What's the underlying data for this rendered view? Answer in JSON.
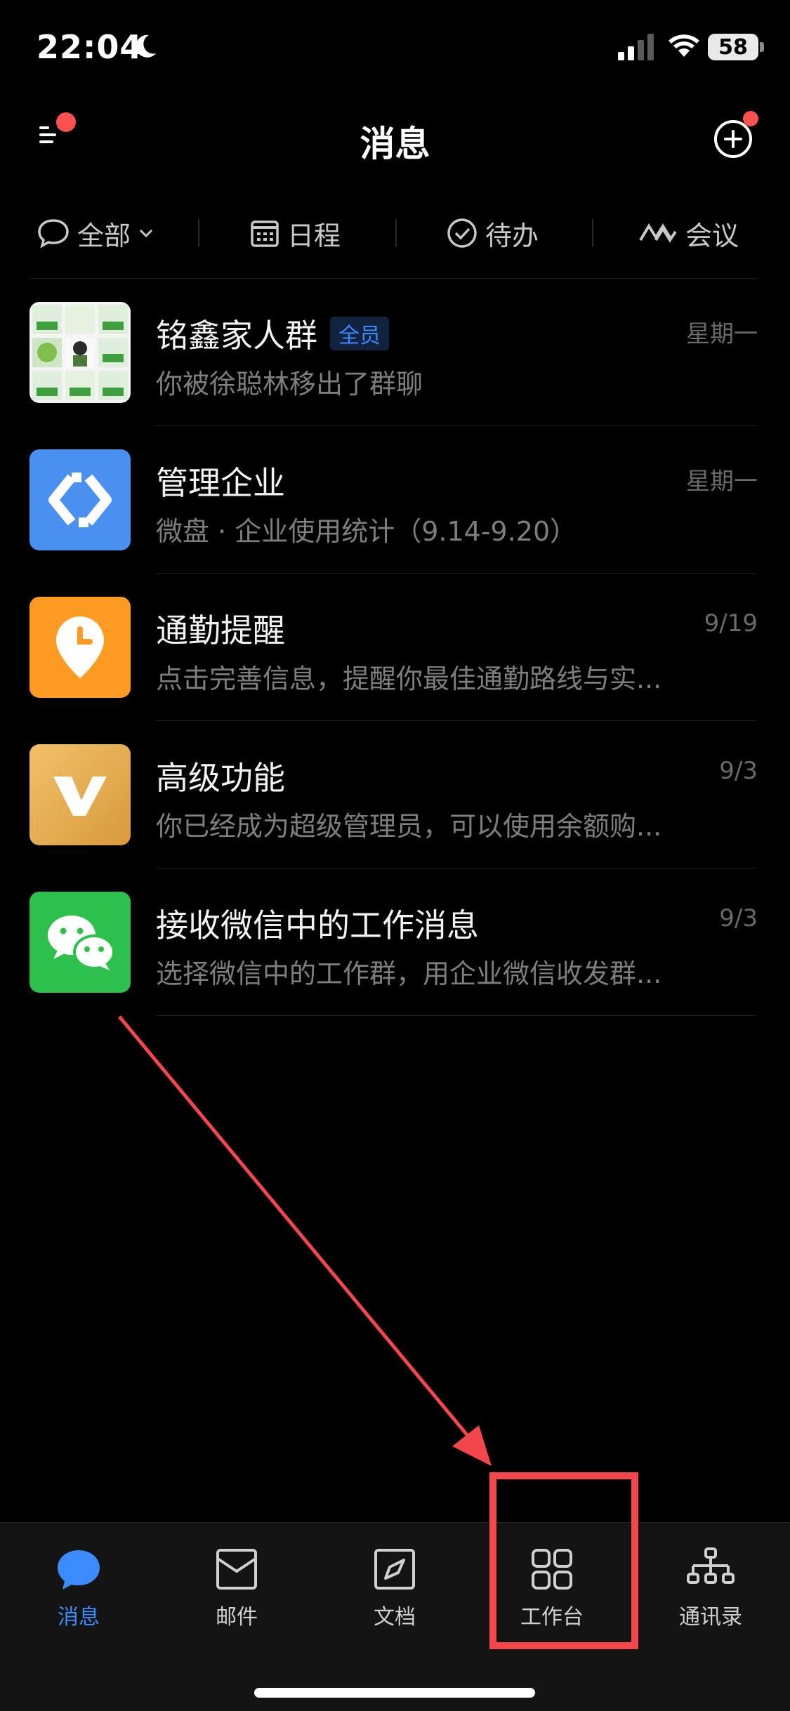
{
  "status": {
    "time": "22:04",
    "battery": "58"
  },
  "header": {
    "title": "消息"
  },
  "filters": [
    {
      "label": "全部",
      "icon": "chat-bubble-icon"
    },
    {
      "label": "日程",
      "icon": "calendar-icon"
    },
    {
      "label": "待办",
      "icon": "check-circle-icon"
    },
    {
      "label": "会议",
      "icon": "meeting-icon"
    }
  ],
  "conversations": [
    {
      "name": "铭鑫家人群",
      "badge": "全员",
      "preview": "你被徐聪林移出了群聊",
      "time": "星期一"
    },
    {
      "name": "管理企业",
      "preview": "微盘 · 企业使用统计（9.14-9.20）",
      "time": "星期一"
    },
    {
      "name": "通勤提醒",
      "preview": "点击完善信息，提醒你最佳通勤路线与实...",
      "time": "9/19"
    },
    {
      "name": "高级功能",
      "preview": "你已经成为超级管理员，可以使用余额购...",
      "time": "9/3"
    },
    {
      "name": "接收微信中的工作消息",
      "preview": "选择微信中的工作群，用企业微信收发群...",
      "time": "9/3"
    }
  ],
  "tabs": [
    {
      "label": "消息",
      "active": true
    },
    {
      "label": "邮件"
    },
    {
      "label": "文档"
    },
    {
      "label": "工作台"
    },
    {
      "label": "通讯录"
    }
  ],
  "colors": {
    "accent": "#3c8cff",
    "annotation": "#f4474d",
    "notify": "#fa5151"
  }
}
